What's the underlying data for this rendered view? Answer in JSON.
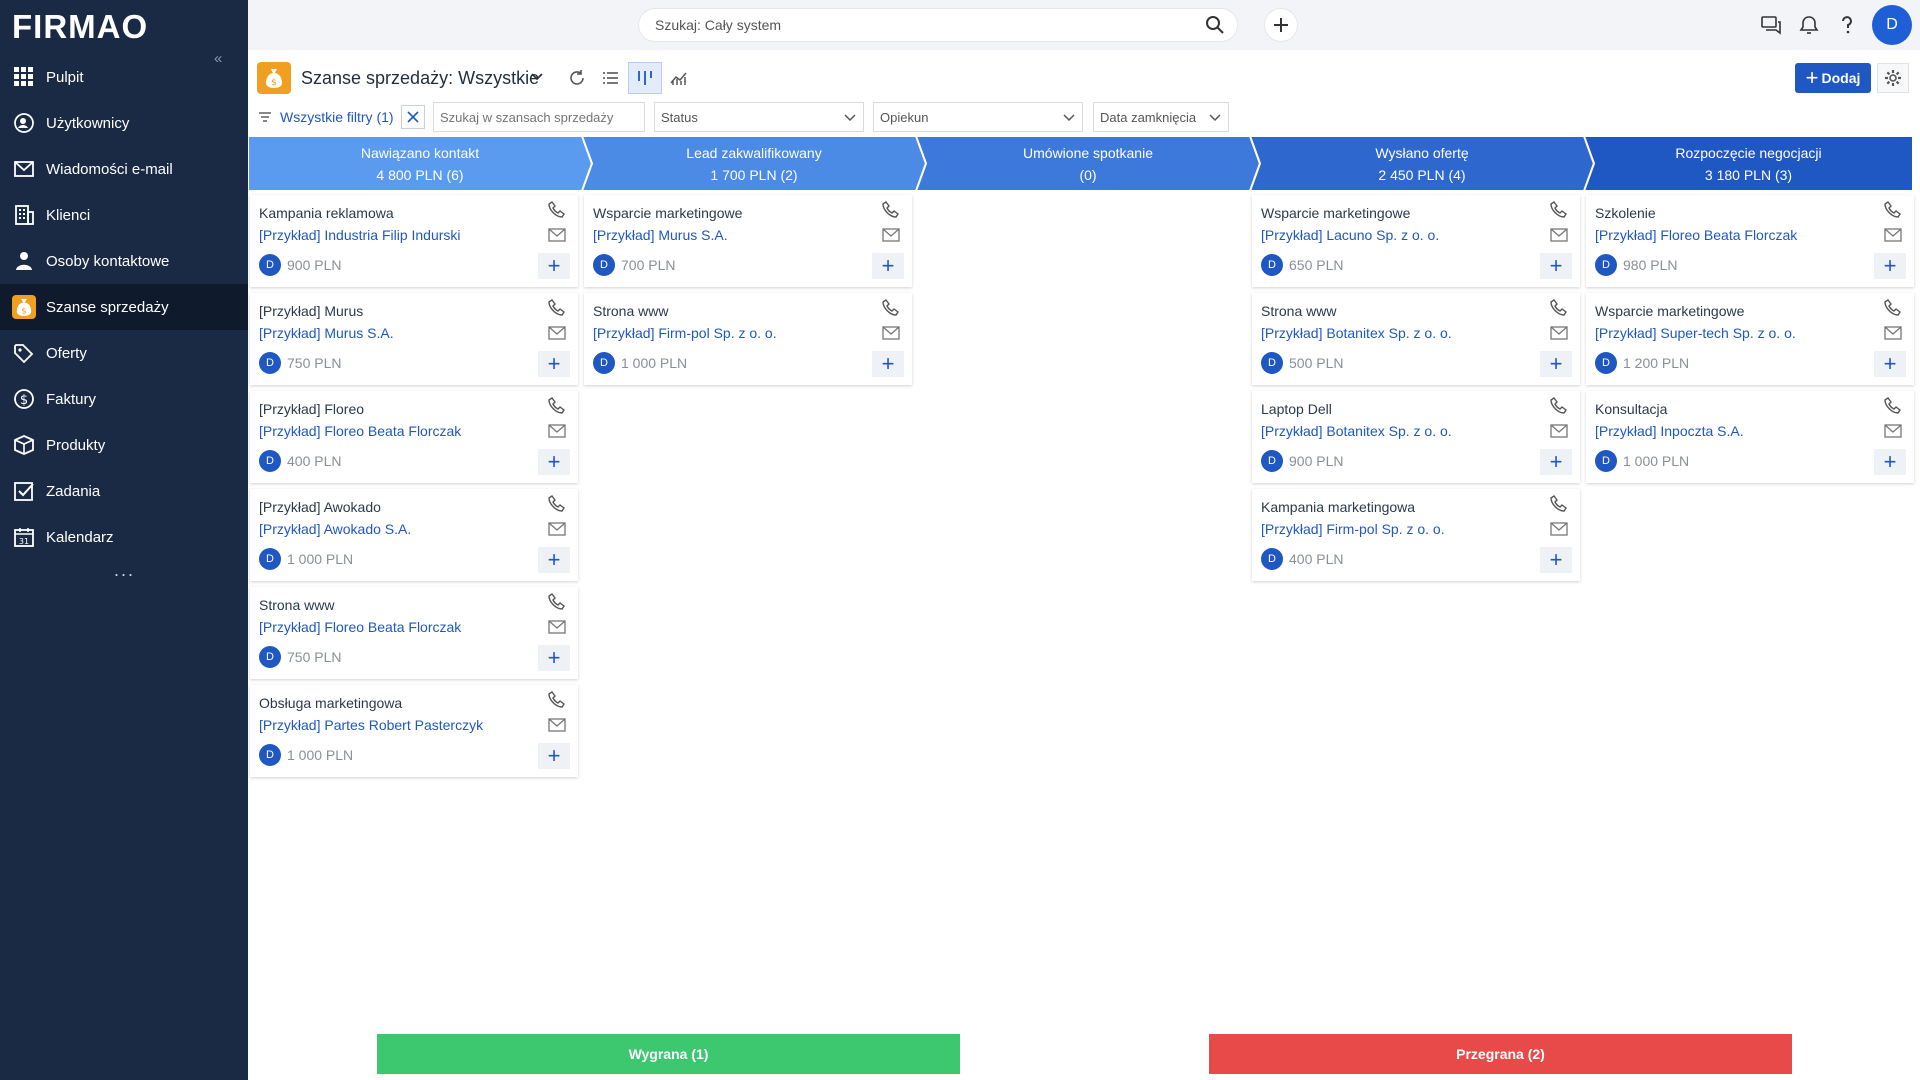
{
  "app": {
    "logo": "FIRMAO",
    "collapse_glyph": "«",
    "more_glyph": "..."
  },
  "sidebar": {
    "items": [
      {
        "label": "Pulpit",
        "icon": "grid-icon"
      },
      {
        "label": "Użytkownicy",
        "icon": "users-icon"
      },
      {
        "label": "Wiadomości e-mail",
        "icon": "mail-icon"
      },
      {
        "label": "Klienci",
        "icon": "building-icon"
      },
      {
        "label": "Osoby kontaktowe",
        "icon": "contacts-icon"
      },
      {
        "label": "Szanse sprzedaży",
        "icon": "moneybag-icon",
        "active": true
      },
      {
        "label": "Oferty",
        "icon": "tag-icon"
      },
      {
        "label": "Faktury",
        "icon": "dollar-icon"
      },
      {
        "label": "Produkty",
        "icon": "box-icon"
      },
      {
        "label": "Zadania",
        "icon": "checkbox-icon"
      },
      {
        "label": "Kalendarz",
        "icon": "calendar-icon"
      }
    ]
  },
  "topbar": {
    "search_placeholder": "Szukaj: Cały system",
    "avatar": "D"
  },
  "header": {
    "title": "Szanse sprzedaży: Wszystkie",
    "add_label": "Dodaj",
    "add_glyph": "+"
  },
  "filters": {
    "all_filters": "Wszystkie filtry (1)",
    "search_placeholder": "Szukaj w szansach sprzedaży",
    "status": "Status",
    "owner": "Opiekun",
    "close_date": "Data zamknięcia"
  },
  "stages": [
    {
      "name": "Nawiązano kontakt",
      "summary": "4 800 PLN (6)"
    },
    {
      "name": "Lead zakwalifikowany",
      "summary": "1 700 PLN (2)"
    },
    {
      "name": "Umówione spotkanie",
      "summary": "(0)"
    },
    {
      "name": "Wysłano ofertę",
      "summary": "2 450 PLN (4)"
    },
    {
      "name": "Rozpoczęcie negocjacji",
      "summary": "3 180 PLN (3)"
    }
  ],
  "columns": [
    [
      {
        "name": "Kampania reklamowa",
        "company": "[Przykład] Industria Filip Indurski",
        "owner": "D",
        "amount": "900 PLN"
      },
      {
        "name": "[Przykład] Murus",
        "company": "[Przykład] Murus S.A.",
        "owner": "D",
        "amount": "750 PLN"
      },
      {
        "name": "[Przykład] Floreo",
        "company": "[Przykład] Floreo Beata Florczak",
        "owner": "D",
        "amount": "400 PLN"
      },
      {
        "name": "[Przykład] Awokado",
        "company": "[Przykład] Awokado S.A.",
        "owner": "D",
        "amount": "1 000 PLN"
      },
      {
        "name": "Strona www",
        "company": "[Przykład] Floreo Beata Florczak",
        "owner": "D",
        "amount": "750 PLN"
      },
      {
        "name": "Obsługa marketingowa",
        "company": "[Przykład] Partes Robert Pasterczyk",
        "owner": "D",
        "amount": "1 000 PLN"
      }
    ],
    [
      {
        "name": "Wsparcie marketingowe",
        "company": "[Przykład] Murus S.A.",
        "owner": "D",
        "amount": "700 PLN"
      },
      {
        "name": "Strona www",
        "company": "[Przykład] Firm-pol Sp. z o. o.",
        "owner": "D",
        "amount": "1 000 PLN"
      }
    ],
    [],
    [
      {
        "name": "Wsparcie marketingowe",
        "company": "[Przykład] Lacuno Sp. z o. o.",
        "owner": "D",
        "amount": "650 PLN"
      },
      {
        "name": "Strona www",
        "company": "[Przykład] Botanitex Sp. z o. o.",
        "owner": "D",
        "amount": "500 PLN"
      },
      {
        "name": "Laptop Dell",
        "company": "[Przykład] Botanitex Sp. z o. o.",
        "owner": "D",
        "amount": "900 PLN"
      },
      {
        "name": "Kampania marketingowa",
        "company": "[Przykład] Firm-pol Sp. z o. o.",
        "owner": "D",
        "amount": "400 PLN"
      }
    ],
    [
      {
        "name": "Szkolenie",
        "company": "[Przykład] Floreo Beata Florczak",
        "owner": "D",
        "amount": "980 PLN"
      },
      {
        "name": "Wsparcie marketingowe",
        "company": "[Przykład] Super-tech Sp. z o. o.",
        "owner": "D",
        "amount": "1 200 PLN"
      },
      {
        "name": "Konsultacja",
        "company": "[Przykład] Inpoczta S.A.",
        "owner": "D",
        "amount": "1 000 PLN"
      }
    ]
  ],
  "card_add_glyph": "+",
  "bottom": {
    "won": "Wygrana (1)",
    "lost": "Przegrana (2)"
  },
  "colors": {
    "sidebar": "#1b2a44",
    "accent": "#1f57c3",
    "stage_start": "#5a9bf0",
    "stage_end": "#1f57c3",
    "won": "#3dc76f",
    "lost": "#e84a4a",
    "moneybag": "#f0a020"
  }
}
